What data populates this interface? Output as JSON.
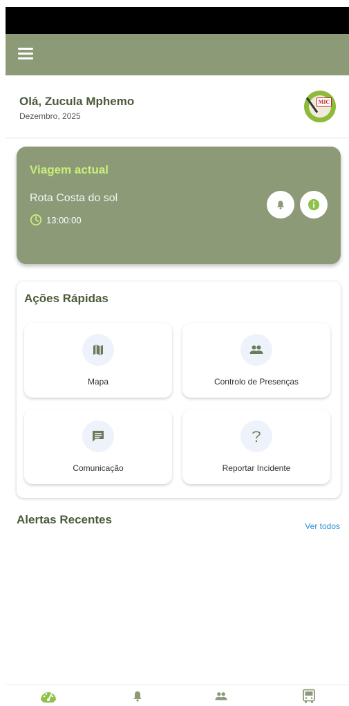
{
  "header": {
    "greeting": "Olá, Zucula Mphemo",
    "date": "Dezembro, 2025",
    "logo_text": "MIC"
  },
  "current_trip": {
    "title": "Viagem actual",
    "route": "Rota Costa do sol",
    "time": "13:00:00"
  },
  "quick_actions": {
    "title": "Ações Rápidas",
    "items": [
      {
        "label": "Mapa",
        "icon": "map-icon"
      },
      {
        "label": "Controlo de Presenças",
        "icon": "people-icon"
      },
      {
        "label": "Comunicação",
        "icon": "chat-icon"
      },
      {
        "label": "Reportar Incidente",
        "icon": "question-icon"
      }
    ]
  },
  "alerts": {
    "title": "Alertas Recentes",
    "link": "Ver todos"
  },
  "bottom_nav": {
    "items": [
      {
        "icon": "dashboard-icon",
        "active": true
      },
      {
        "icon": "bell-icon",
        "active": false
      },
      {
        "icon": "people-icon",
        "active": false
      },
      {
        "icon": "bus-icon",
        "active": false
      }
    ]
  },
  "colors": {
    "brand": "#8c9a78",
    "accent": "#c9ef7a",
    "link": "#2a8fd6"
  }
}
